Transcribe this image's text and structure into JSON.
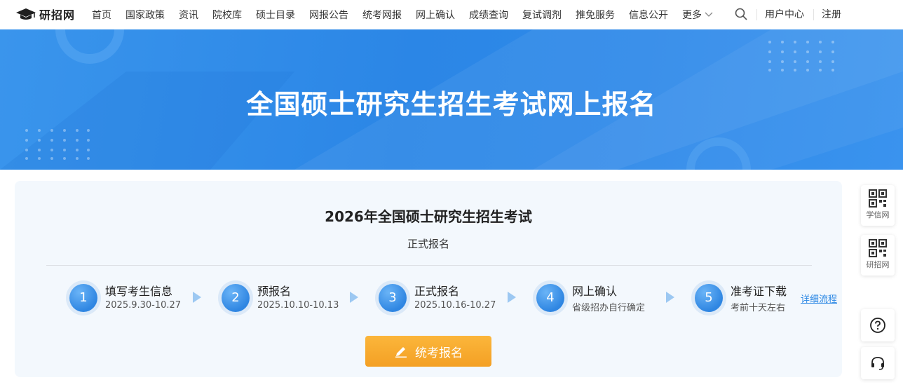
{
  "header": {
    "logo_text": "研招网",
    "nav": [
      "首页",
      "国家政策",
      "资讯",
      "院校库",
      "硕士目录",
      "网报公告",
      "统考网报",
      "网上确认",
      "成绩查询",
      "复试调剂",
      "推免服务",
      "信息公开"
    ],
    "more_label": "更多",
    "user_center": "用户中心",
    "register": "注册"
  },
  "banner": {
    "title": "全国硕士研究生招生考试网上报名"
  },
  "card": {
    "title": "2026年全国硕士研究生招生考试",
    "subtitle": "正式报名",
    "steps": [
      {
        "num": "1",
        "name": "填写考生信息",
        "date": "2025.9.30-10.27"
      },
      {
        "num": "2",
        "name": "预报名",
        "date": "2025.10.10-10.13"
      },
      {
        "num": "3",
        "name": "正式报名",
        "date": "2025.10.16-10.27"
      },
      {
        "num": "4",
        "name": "网上确认",
        "date": "省级招办自行确定"
      },
      {
        "num": "5",
        "name": "准考证下载",
        "date": "考前十天左右"
      }
    ],
    "detail_link": "详细流程",
    "button_label": "统考报名"
  },
  "sidebar": {
    "xuexin": "学信网",
    "yanzhao": "研招网"
  },
  "colors": {
    "primary": "#2f86e2",
    "button": "#f4a024",
    "banner": "#2b86e6"
  }
}
